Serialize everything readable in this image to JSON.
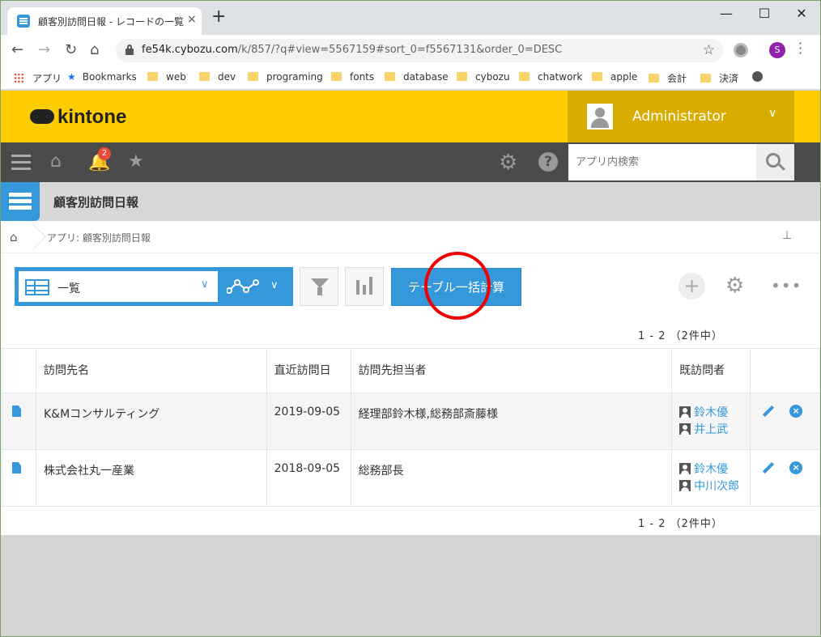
{
  "browser": {
    "tab_title": "顧客別訪問日報 - レコードの一覧",
    "tab_close": "×",
    "new_tab": "+",
    "minimize": "—",
    "maximize": "☐",
    "close": "✕",
    "url_host": "fe54k.cybozu.com",
    "url_path": "/k/857/?q#view=5567159#sort_0=f5567131&order_0=DESC",
    "profile_initial": "S",
    "bookmarks": [
      "アプリ",
      "Bookmarks",
      "web",
      "dev",
      "programing",
      "fonts",
      "database",
      "cybozu",
      "chatwork",
      "apple",
      "会計",
      "決済"
    ]
  },
  "header": {
    "logo": "kintone",
    "user_name": "Administrator",
    "notification_count": "2",
    "search_placeholder": "アプリ内検索"
  },
  "app": {
    "title": "顧客別訪問日報",
    "breadcrumb": "アプリ: 顧客別訪問日報"
  },
  "toolbar": {
    "view_name": "一覧",
    "bulk_calc_label": "テーブル一括計算",
    "add_label": "+",
    "more_label": "•••"
  },
  "pager": "1 - 2 （2件中）",
  "table": {
    "headers": [
      "訪問先名",
      "直近訪問日",
      "訪問先担当者",
      "既訪問者"
    ],
    "rows": [
      {
        "name": "K&Mコンサルティング",
        "date": "2019-09-05",
        "contact": "経理部鈴木様,総務部斎藤様",
        "visitors": [
          "鈴木優",
          "井上武"
        ]
      },
      {
        "name": "株式会社丸一産業",
        "date": "2018-09-05",
        "contact": "総務部長",
        "visitors": [
          "鈴木優",
          "中川次郎"
        ]
      }
    ]
  },
  "colors": {
    "brand": "#ffcc00",
    "accent": "#3498db",
    "nav": "#4b4b4b",
    "highlight_circle": "#ee0000"
  }
}
